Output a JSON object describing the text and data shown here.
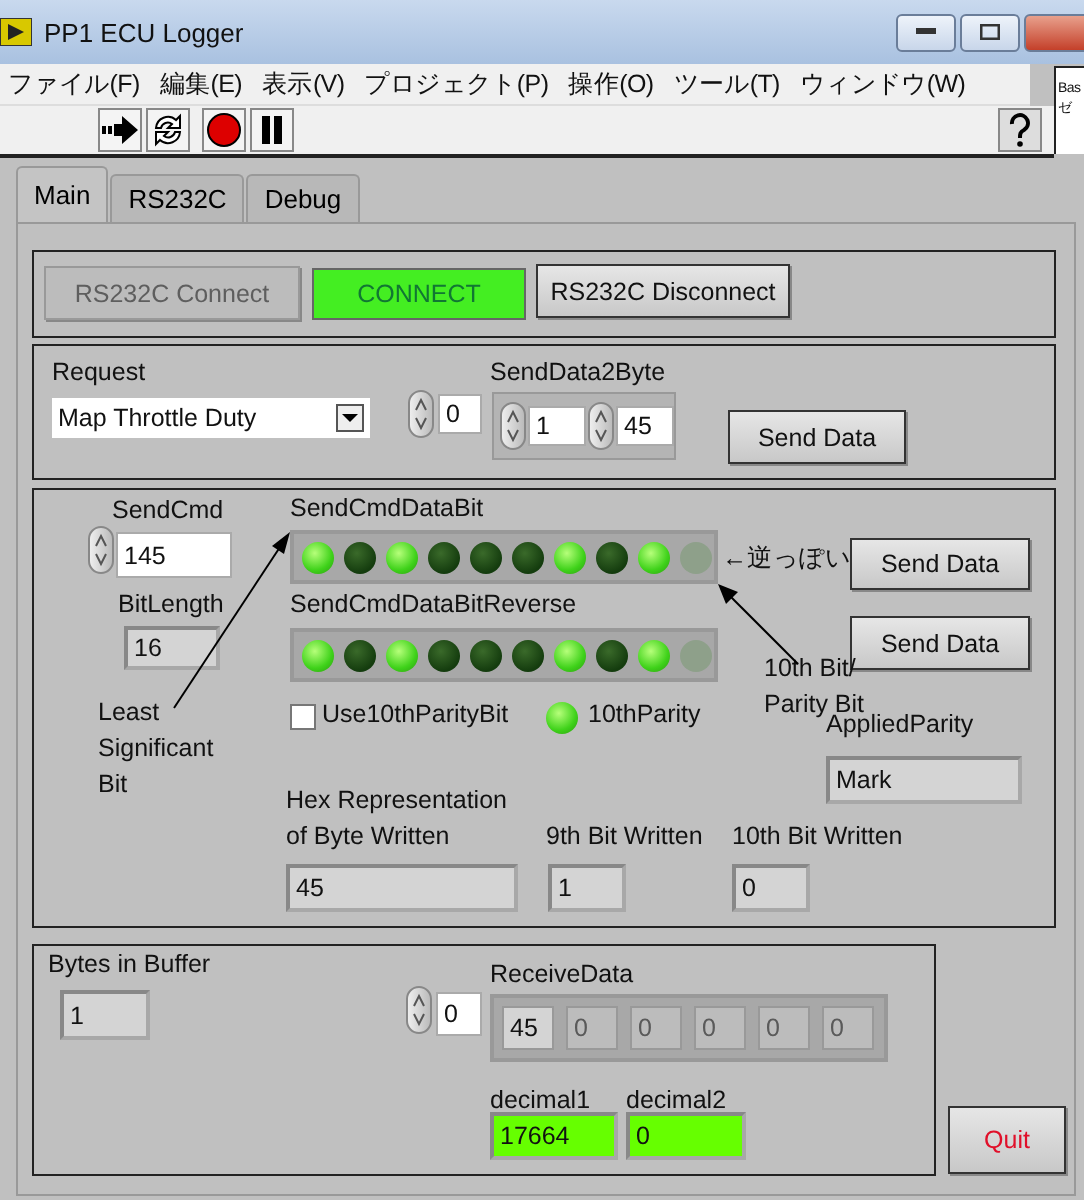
{
  "window": {
    "title": "PP1 ECU Logger"
  },
  "menu": [
    "ファイル(F)",
    "編集(E)",
    "表示(V)",
    "プロジェクト(P)",
    "操作(O)",
    "ツール(T)",
    "ウィンドウ(W)"
  ],
  "side_window": {
    "lines": [
      "Bas",
      "ゼ"
    ]
  },
  "tabs": [
    {
      "label": "Main",
      "selected": true
    },
    {
      "label": "RS232C",
      "selected": false
    },
    {
      "label": "Debug",
      "selected": false
    }
  ],
  "connection": {
    "connect_button": {
      "label": "RS232C Connect",
      "disabled": true
    },
    "status": {
      "label": "CONNECT",
      "on": true
    },
    "disconnect_button": {
      "label": "RS232C Disconnect",
      "disabled": false
    }
  },
  "request": {
    "label": "Request",
    "value": "Map Throttle Duty",
    "index": "0",
    "send_data2byte": {
      "label": "SendData2Byte",
      "values": [
        "1",
        "45"
      ]
    },
    "send_button": "Send Data"
  },
  "command": {
    "send_cmd": {
      "label": "SendCmd",
      "value": "145"
    },
    "bit_length": {
      "label": "BitLength",
      "value": "16"
    },
    "data_bit": {
      "label": "SendCmdDataBit",
      "leds": [
        {
          "on": true,
          "disabled": false
        },
        {
          "on": false,
          "disabled": false
        },
        {
          "on": true,
          "disabled": false
        },
        {
          "on": false,
          "disabled": false
        },
        {
          "on": false,
          "disabled": false
        },
        {
          "on": false,
          "disabled": false
        },
        {
          "on": true,
          "disabled": false
        },
        {
          "on": false,
          "disabled": false
        },
        {
          "on": true,
          "disabled": false
        },
        {
          "on": false,
          "disabled": true
        }
      ]
    },
    "note": "←逆っぽい",
    "send_buttons": [
      "Send Data",
      "Send Data"
    ],
    "data_bit_reverse": {
      "label": "SendCmdDataBitReverse",
      "leds": [
        {
          "on": true,
          "disabled": false
        },
        {
          "on": false,
          "disabled": false
        },
        {
          "on": true,
          "disabled": false
        },
        {
          "on": false,
          "disabled": false
        },
        {
          "on": false,
          "disabled": false
        },
        {
          "on": false,
          "disabled": false
        },
        {
          "on": true,
          "disabled": false
        },
        {
          "on": false,
          "disabled": false
        },
        {
          "on": true,
          "disabled": false
        },
        {
          "on": false,
          "disabled": true
        }
      ]
    },
    "tenth_bit_note": "10th Bit/\nParity Bit",
    "lsb_note": "Least\nSignificant\nBit",
    "use_parity": {
      "label": "Use10thParityBit",
      "checked": false
    },
    "parity_led": {
      "label": "10thParity",
      "on": true
    },
    "applied_parity": {
      "label": "AppliedParity",
      "value": "Mark"
    },
    "hex": {
      "label": "Hex Representation\nof Byte Written",
      "value": "45"
    },
    "ninth": {
      "label": "9th Bit Written",
      "value": "1"
    },
    "tenth": {
      "label": "10th Bit Written",
      "value": "0"
    }
  },
  "receive": {
    "bytes_in_buffer": {
      "label": "Bytes in Buffer",
      "value": "1"
    },
    "index": "0",
    "receive_data": {
      "label": "ReceiveData",
      "cells": [
        {
          "value": "45",
          "disabled": false
        },
        {
          "value": "0",
          "disabled": true
        },
        {
          "value": "0",
          "disabled": true
        },
        {
          "value": "0",
          "disabled": true
        },
        {
          "value": "0",
          "disabled": true
        },
        {
          "value": "0",
          "disabled": true
        }
      ]
    },
    "decimal1": {
      "label": "decimal1",
      "value": "17664"
    },
    "decimal2": {
      "label": "decimal2",
      "value": "0"
    }
  },
  "quit_button": "Quit"
}
